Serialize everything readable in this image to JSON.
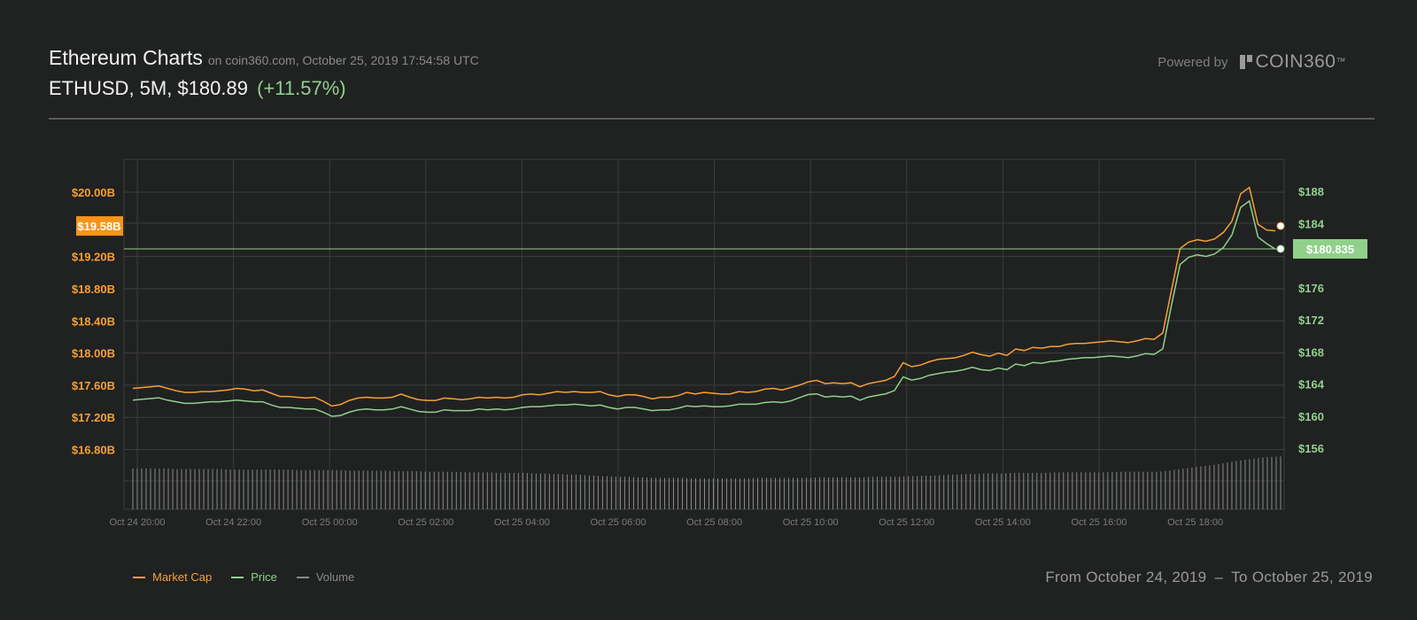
{
  "header": {
    "title": "Ethereum Charts",
    "subtitle": "on coin360.com, October 25, 2019 17:54:58 UTC",
    "pair_info": "ETHUSD, 5M, $180.89",
    "change": "(+11.57%)",
    "powered_by": "Powered by",
    "logo_text": "COIN360",
    "logo_tm": "™"
  },
  "colors": {
    "market_cap": "#f7a035",
    "price": "#8fd18b",
    "volume": "#8a8a8a",
    "background": "#202121",
    "grid": "#3c3d3d"
  },
  "chart_data": {
    "type": "line",
    "x_ticks": [
      "Oct 24 20:00",
      "Oct 24 22:00",
      "Oct 25 00:00",
      "Oct 25 02:00",
      "Oct 25 04:00",
      "Oct 25 06:00",
      "Oct 25 08:00",
      "Oct 25 10:00",
      "Oct 25 12:00",
      "Oct 25 14:00",
      "Oct 25 16:00",
      "Oct 25 18:00"
    ],
    "left_axis": {
      "ticks": [
        "$20.00B",
        "$19.20B",
        "$18.80B",
        "$18.40B",
        "$18.00B",
        "$17.60B",
        "$17.20B",
        "$16.80B"
      ],
      "tick_values": [
        20.0,
        19.2,
        18.8,
        18.4,
        18.0,
        17.6,
        17.2,
        16.8
      ],
      "current_label": "$19.58B",
      "current_value": 19.58
    },
    "right_axis": {
      "ticks": [
        "$188",
        "$184",
        "$176",
        "$172",
        "$168",
        "$164",
        "$160",
        "$156"
      ],
      "tick_values": [
        188,
        184,
        176,
        172,
        168,
        164,
        160,
        156
      ],
      "current_label": "$180.835",
      "current_value": 180.835
    },
    "series": [
      {
        "name": "Market Cap",
        "unit": "B USD",
        "values": [
          17.56,
          17.57,
          17.58,
          17.59,
          17.56,
          17.53,
          17.51,
          17.51,
          17.52,
          17.52,
          17.53,
          17.54,
          17.56,
          17.55,
          17.53,
          17.54,
          17.5,
          17.46,
          17.46,
          17.45,
          17.44,
          17.45,
          17.4,
          17.34,
          17.36,
          17.41,
          17.44,
          17.45,
          17.44,
          17.44,
          17.45,
          17.49,
          17.45,
          17.42,
          17.41,
          17.41,
          17.44,
          17.43,
          17.42,
          17.43,
          17.45,
          17.44,
          17.45,
          17.44,
          17.45,
          17.48,
          17.49,
          17.48,
          17.5,
          17.52,
          17.51,
          17.52,
          17.51,
          17.51,
          17.52,
          17.48,
          17.46,
          17.48,
          17.48,
          17.46,
          17.43,
          17.45,
          17.45,
          17.47,
          17.51,
          17.49,
          17.51,
          17.5,
          17.49,
          17.49,
          17.52,
          17.51,
          17.52,
          17.55,
          17.56,
          17.54,
          17.57,
          17.6,
          17.64,
          17.66,
          17.62,
          17.63,
          17.62,
          17.63,
          17.58,
          17.62,
          17.64,
          17.66,
          17.71,
          17.88,
          17.83,
          17.85,
          17.89,
          17.92,
          17.93,
          17.94,
          17.97,
          18.01,
          17.98,
          17.96,
          18.0,
          17.97,
          18.05,
          18.03,
          18.07,
          18.06,
          18.08,
          18.08,
          18.11,
          18.12,
          18.12,
          18.13,
          18.14,
          18.15,
          18.14,
          18.13,
          18.15,
          18.18,
          18.17,
          18.25,
          18.78,
          19.3,
          19.38,
          19.41,
          19.39,
          19.42,
          19.5,
          19.64,
          19.98,
          20.06,
          19.6,
          19.53,
          19.52
        ]
      },
      {
        "name": "Price",
        "unit": "USD",
        "values": [
          162.0,
          162.1,
          162.2,
          162.3,
          162.0,
          161.8,
          161.6,
          161.6,
          161.7,
          161.8,
          161.8,
          161.9,
          162.0,
          161.9,
          161.8,
          161.8,
          161.4,
          161.1,
          161.1,
          161.0,
          160.9,
          160.9,
          160.5,
          160.0,
          160.1,
          160.5,
          160.8,
          160.9,
          160.8,
          160.8,
          160.9,
          161.2,
          160.9,
          160.6,
          160.5,
          160.5,
          160.8,
          160.7,
          160.7,
          160.7,
          160.9,
          160.8,
          160.9,
          160.8,
          160.9,
          161.1,
          161.2,
          161.2,
          161.3,
          161.4,
          161.4,
          161.5,
          161.4,
          161.3,
          161.4,
          161.1,
          160.9,
          161.1,
          161.1,
          160.9,
          160.7,
          160.8,
          160.8,
          161.0,
          161.3,
          161.2,
          161.3,
          161.2,
          161.2,
          161.3,
          161.5,
          161.5,
          161.5,
          161.7,
          161.8,
          161.7,
          161.9,
          162.3,
          162.7,
          162.8,
          162.4,
          162.5,
          162.4,
          162.5,
          162.0,
          162.4,
          162.6,
          162.8,
          163.2,
          164.9,
          164.5,
          164.7,
          165.1,
          165.3,
          165.5,
          165.6,
          165.8,
          166.1,
          165.8,
          165.7,
          166.0,
          165.8,
          166.5,
          166.3,
          166.7,
          166.6,
          166.8,
          166.9,
          167.1,
          167.2,
          167.3,
          167.3,
          167.4,
          167.5,
          167.4,
          167.3,
          167.5,
          167.8,
          167.7,
          168.4,
          173.8,
          178.9,
          179.8,
          180.1,
          179.9,
          180.2,
          181.0,
          182.6,
          186.0,
          186.8,
          182.3,
          181.5,
          180.8
        ]
      },
      {
        "name": "Volume",
        "values": [
          0.74,
          0.74,
          0.74,
          0.74,
          0.74,
          0.73,
          0.73,
          0.73,
          0.73,
          0.73,
          0.73,
          0.72,
          0.72,
          0.72,
          0.72,
          0.72,
          0.72,
          0.72,
          0.72,
          0.71,
          0.71,
          0.71,
          0.71,
          0.71,
          0.71,
          0.7,
          0.7,
          0.7,
          0.7,
          0.7,
          0.69,
          0.69,
          0.69,
          0.69,
          0.68,
          0.68,
          0.68,
          0.68,
          0.67,
          0.67,
          0.67,
          0.67,
          0.66,
          0.66,
          0.66,
          0.66,
          0.65,
          0.65,
          0.64,
          0.64,
          0.63,
          0.63,
          0.62,
          0.61,
          0.6,
          0.6,
          0.59,
          0.59,
          0.58,
          0.58,
          0.57,
          0.57,
          0.57,
          0.57,
          0.56,
          0.56,
          0.56,
          0.56,
          0.56,
          0.56,
          0.56,
          0.56,
          0.57,
          0.57,
          0.57,
          0.57,
          0.57,
          0.57,
          0.57,
          0.58,
          0.58,
          0.58,
          0.58,
          0.58,
          0.58,
          0.59,
          0.59,
          0.59,
          0.59,
          0.6,
          0.6,
          0.61,
          0.61,
          0.62,
          0.63,
          0.63,
          0.64,
          0.64,
          0.65,
          0.65,
          0.65,
          0.66,
          0.66,
          0.66,
          0.66,
          0.66,
          0.67,
          0.67,
          0.67,
          0.67,
          0.67,
          0.67,
          0.67,
          0.68,
          0.68,
          0.68,
          0.68,
          0.68,
          0.68,
          0.7,
          0.72,
          0.74,
          0.76,
          0.78,
          0.8,
          0.82,
          0.85,
          0.88,
          0.9,
          0.92,
          0.94,
          0.95,
          0.96
        ]
      }
    ],
    "grid": true,
    "legend_position": "bottom-left"
  },
  "legend": [
    {
      "label": "Market Cap",
      "color": "#f7a035"
    },
    {
      "label": "Price",
      "color": "#8fd18b"
    },
    {
      "label": "Volume",
      "color": "#8a8a8a"
    }
  ],
  "footer": {
    "from_label": "From October 24, 2019",
    "separator": "–",
    "to_label": "To October 25, 2019"
  }
}
